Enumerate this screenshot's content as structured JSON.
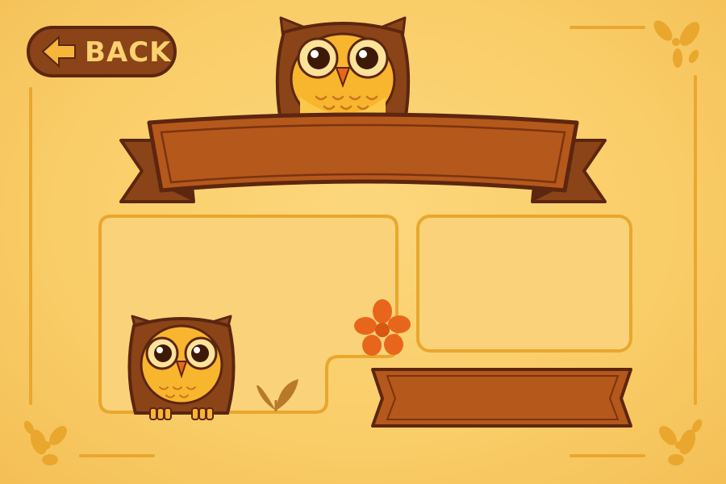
{
  "back_button": {
    "label": "BACK",
    "icon": "arrow-left-icon"
  },
  "title_banner": {
    "text": ""
  },
  "left_panel": {
    "text": ""
  },
  "right_panel": {
    "text": ""
  },
  "right_banner": {
    "text": ""
  },
  "colors": {
    "background": "#f9cf6d",
    "frame_line": "#e9a72d",
    "banner_face": "#b5581b",
    "banner_outline": "#5c2610",
    "owl_body": "#8a4418",
    "owl_face": "#f8b52e",
    "flower": "#e8661b",
    "leaf": "#b67a2a"
  }
}
